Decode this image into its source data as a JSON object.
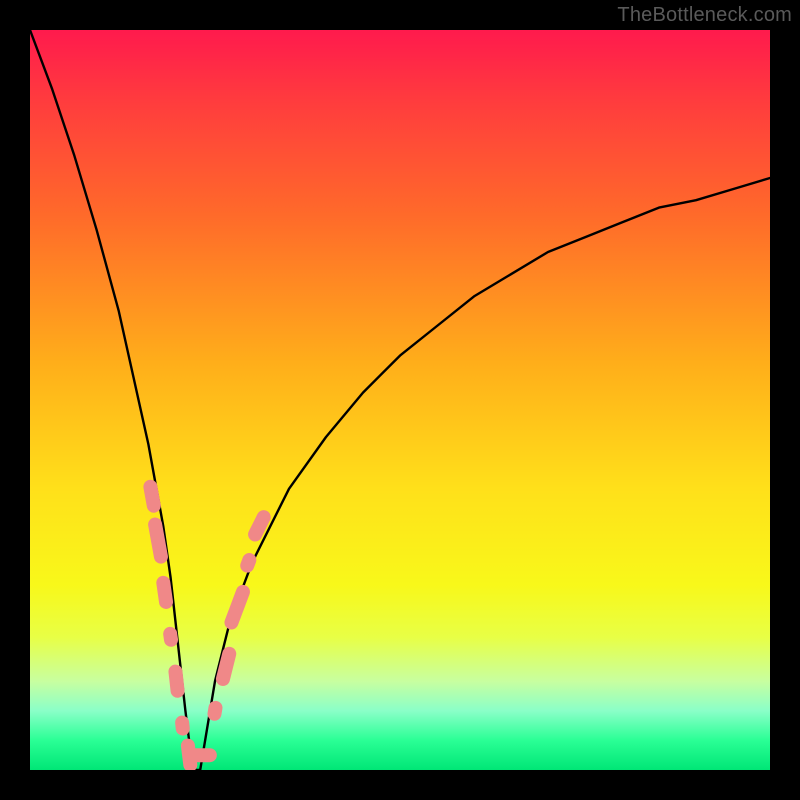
{
  "watermark": "TheBottleneck.com",
  "colors": {
    "frame": "#000000",
    "curve": "#000000",
    "marker_fill": "#f08888",
    "marker_stroke": "#f08888",
    "gradient_top": "#ff1a4d",
    "gradient_bottom": "#00e676"
  },
  "chart_data": {
    "type": "line",
    "title": "",
    "xlabel": "",
    "ylabel": "",
    "xlim": [
      0,
      100
    ],
    "ylim": [
      0,
      100
    ],
    "notes": "V-shaped bottleneck curve. Y ≈ 100 at x=0, drops to ~0 near x≈22, rises back toward ~80 at x=100. Markers cluster on both flanks near the trough.",
    "series": [
      {
        "name": "bottleneck-curve",
        "x": [
          0,
          3,
          6,
          9,
          12,
          14,
          16,
          18,
          19,
          20,
          21,
          22,
          23,
          24,
          25,
          27,
          30,
          35,
          40,
          45,
          50,
          55,
          60,
          65,
          70,
          75,
          80,
          85,
          90,
          95,
          100
        ],
        "y": [
          100,
          92,
          83,
          73,
          62,
          53,
          44,
          33,
          26,
          17,
          8,
          0,
          0,
          6,
          12,
          20,
          28,
          38,
          45,
          51,
          56,
          60,
          64,
          67,
          70,
          72,
          74,
          76,
          77,
          78.5,
          80
        ]
      }
    ],
    "markers": [
      {
        "x": 16.5,
        "y": 37,
        "shape": "pill",
        "len": 5
      },
      {
        "x": 17.3,
        "y": 31,
        "shape": "pill",
        "len": 7
      },
      {
        "x": 18.2,
        "y": 24,
        "shape": "pill",
        "len": 5
      },
      {
        "x": 19.0,
        "y": 18,
        "shape": "round",
        "len": 3
      },
      {
        "x": 19.8,
        "y": 12,
        "shape": "pill",
        "len": 5
      },
      {
        "x": 20.6,
        "y": 6,
        "shape": "round",
        "len": 3
      },
      {
        "x": 21.5,
        "y": 2,
        "shape": "pill",
        "len": 5
      },
      {
        "x": 23.0,
        "y": 2,
        "shape": "pill",
        "len": 5
      },
      {
        "x": 25.0,
        "y": 8,
        "shape": "round",
        "len": 3
      },
      {
        "x": 26.5,
        "y": 14,
        "shape": "pill",
        "len": 6
      },
      {
        "x": 28.0,
        "y": 22,
        "shape": "pill",
        "len": 7
      },
      {
        "x": 29.5,
        "y": 28,
        "shape": "round",
        "len": 3
      },
      {
        "x": 31.0,
        "y": 33,
        "shape": "pill",
        "len": 5
      }
    ]
  }
}
